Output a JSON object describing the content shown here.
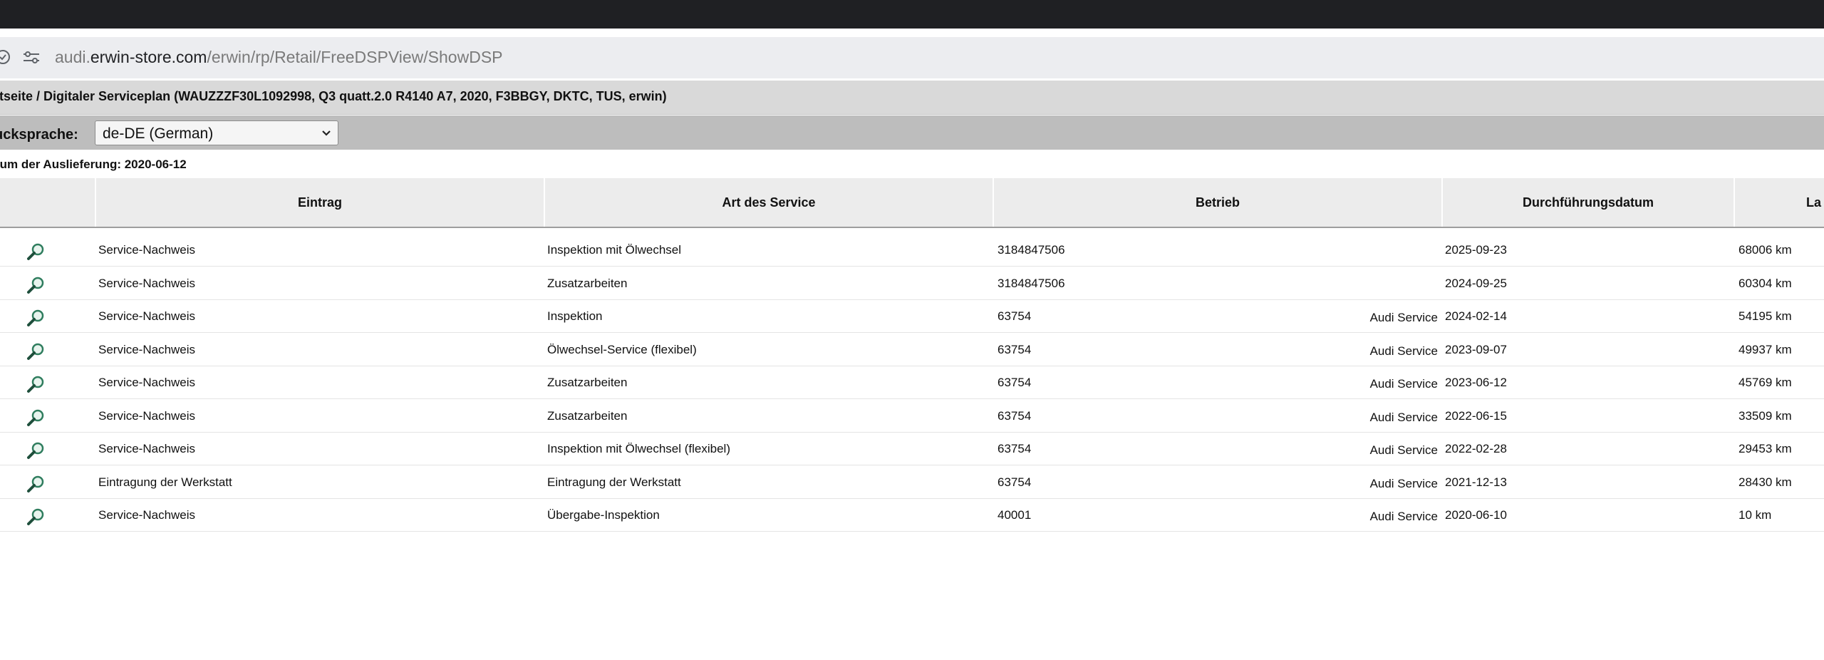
{
  "browser": {
    "url_prefix": "audi.",
    "url_domain": "erwin-store.com",
    "url_path": "/erwin/rp/Retail/FreeDSPView/ShowDSP",
    "site_info_icon": "site-info-icon",
    "tune_icon": "tune-icon"
  },
  "breadcrumb": "rtseite / Digitaler Serviceplan (WAUZZZF30L1092998, Q3 quatt.2.0 R4140 A7, 2020, F3BBGY, DKTC, TUS, erwin)",
  "language": {
    "label": "ucksprache:",
    "selected": "de-DE (German)"
  },
  "delivery": "tum der Auslieferung: 2020-06-12",
  "table": {
    "columns": [
      "",
      "Eintrag",
      "Art des Service",
      "Betrieb",
      "Durchführungsdatum",
      "La"
    ],
    "rows": [
      {
        "eintrag": "Service-Nachweis",
        "art": "Inspektion mit Ölwechsel",
        "betrieb_id": "3184847506",
        "betrieb_name": "",
        "datum": "2025-09-23",
        "km": "68006 km"
      },
      {
        "eintrag": "Service-Nachweis",
        "art": "Zusatzarbeiten",
        "betrieb_id": "3184847506",
        "betrieb_name": "",
        "datum": "2024-09-25",
        "km": "60304 km"
      },
      {
        "eintrag": "Service-Nachweis",
        "art": "Inspektion",
        "betrieb_id": "63754",
        "betrieb_name": "Audi Service",
        "datum": "2024-02-14",
        "km": "54195 km"
      },
      {
        "eintrag": "Service-Nachweis",
        "art": "Ölwechsel-Service (flexibel)",
        "betrieb_id": "63754",
        "betrieb_name": "Audi Service",
        "datum": "2023-09-07",
        "km": "49937 km"
      },
      {
        "eintrag": "Service-Nachweis",
        "art": "Zusatzarbeiten",
        "betrieb_id": "63754",
        "betrieb_name": "Audi Service",
        "datum": "2023-06-12",
        "km": "45769 km"
      },
      {
        "eintrag": "Service-Nachweis",
        "art": "Zusatzarbeiten",
        "betrieb_id": "63754",
        "betrieb_name": "Audi Service",
        "datum": "2022-06-15",
        "km": "33509 km"
      },
      {
        "eintrag": "Service-Nachweis",
        "art": "Inspektion mit Ölwechsel (flexibel)",
        "betrieb_id": "63754",
        "betrieb_name": "Audi Service",
        "datum": "2022-02-28",
        "km": "29453 km"
      },
      {
        "eintrag": "Eintragung der Werkstatt",
        "art": "Eintragung der Werkstatt",
        "betrieb_id": "63754",
        "betrieb_name": "Audi Service",
        "datum": "2021-12-13",
        "km": "28430 km"
      },
      {
        "eintrag": "Service-Nachweis",
        "art": "Übergabe-Inspektion",
        "betrieb_id": "40001",
        "betrieb_name": "Audi Service",
        "datum": "2020-06-10",
        "km": "10 km"
      }
    ]
  },
  "colors": {
    "topbar": "#1f2023",
    "addressbar": "#ecedf0",
    "breadcrumb_bg": "#d9d9d9",
    "language_bg": "#bdbdbd",
    "header_bg": "#ececec",
    "magnifier": "#2f7d5e"
  }
}
